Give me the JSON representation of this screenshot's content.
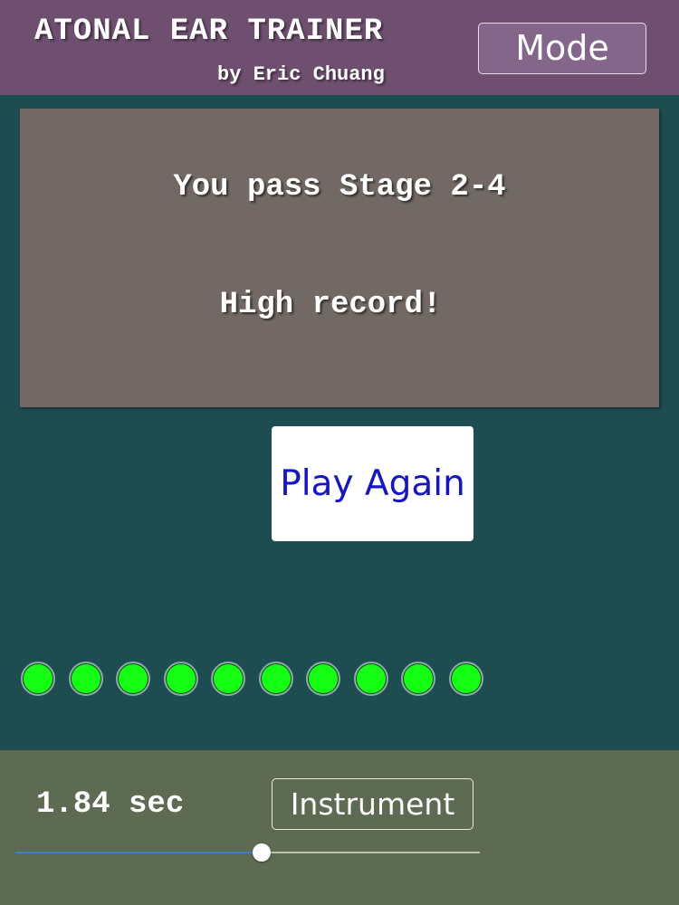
{
  "header": {
    "title": "ATONAL EAR TRAINER",
    "author": "by Eric Chuang",
    "mode_button_label": "Mode"
  },
  "result": {
    "stage_message": "You pass Stage 2-4",
    "record_message": "High record!"
  },
  "play_again_label": "Play Again",
  "progress": {
    "completed": 10,
    "total": 10,
    "dot_color": "#14ff14"
  },
  "controls": {
    "duration_text": "1.84 sec",
    "instrument_button_label": "Instrument",
    "slider_value": 0.53
  },
  "colors": {
    "header_bg": "#6f4f6f",
    "main_bg": "#1d4d51",
    "panel_bg": "#726964",
    "bottom_bg": "#5d6b52",
    "play_again_text": "#1414cc"
  }
}
